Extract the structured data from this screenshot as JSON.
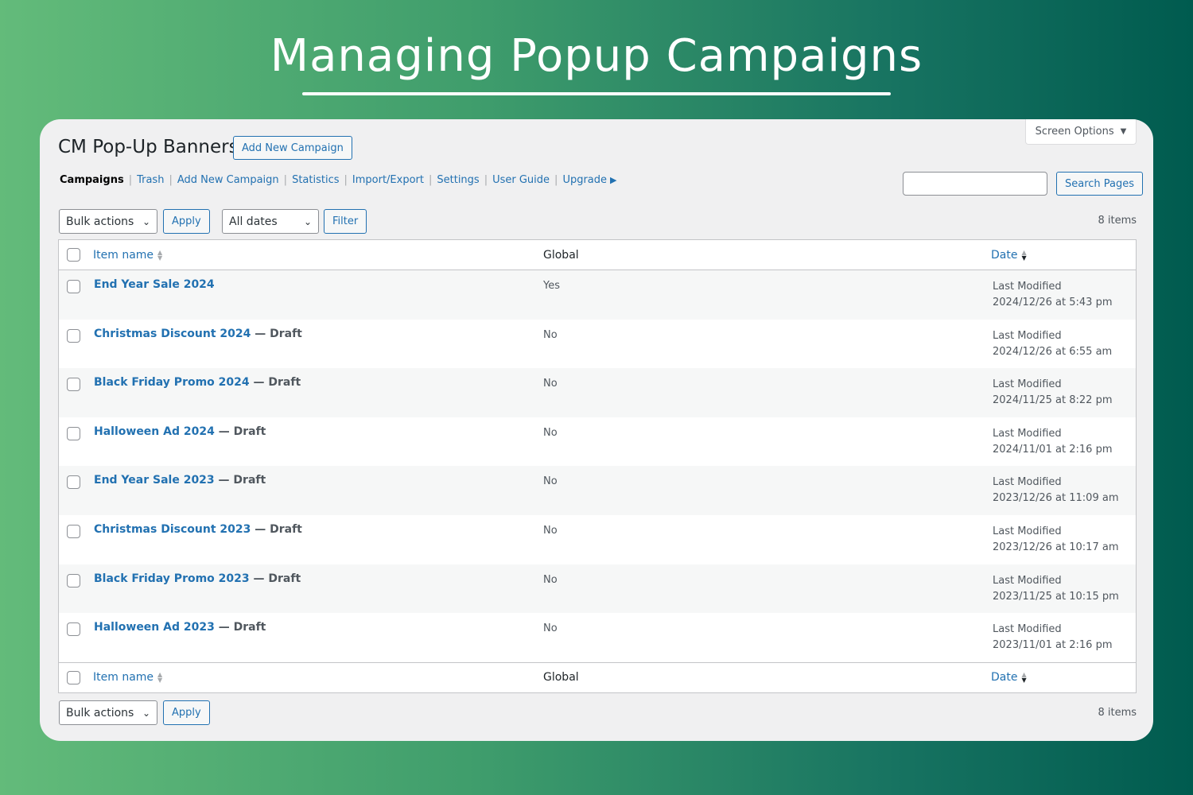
{
  "hero": {
    "title": "Managing Popup Campaigns"
  },
  "header": {
    "title": "CM Pop-Up Banners",
    "add_new_label": "Add New Campaign",
    "screen_options_label": "Screen Options",
    "screen_options_icon": "caret-down-icon"
  },
  "subnav": {
    "items": [
      {
        "label": "Campaigns",
        "current": true
      },
      {
        "label": "Trash"
      },
      {
        "label": "Add New Campaign"
      },
      {
        "label": "Statistics"
      },
      {
        "label": "Import/Export"
      },
      {
        "label": "Settings"
      },
      {
        "label": "User Guide"
      },
      {
        "label": "Upgrade"
      }
    ],
    "separator": "|",
    "upgrade_icon": "arrow-right-icon"
  },
  "search": {
    "value": "",
    "placeholder": "",
    "button_label": "Search Pages"
  },
  "toolbar_top": {
    "bulk_actions": "Bulk actions",
    "apply": "Apply",
    "dates": "All dates",
    "filter": "Filter",
    "count": "8 items"
  },
  "table": {
    "columns": {
      "name": "Item name",
      "global": "Global",
      "date": "Date"
    },
    "rows": [
      {
        "name": "End Year Sale 2024",
        "state": "",
        "global": "Yes",
        "date_label": "Last Modified",
        "date": "2024/12/26 at 5:43 pm"
      },
      {
        "name": "Christmas Discount 2024",
        "state": " — Draft",
        "global": "No",
        "date_label": "Last Modified",
        "date": "2024/12/26 at 6:55 am"
      },
      {
        "name": "Black Friday Promo 2024",
        "state": " — Draft",
        "global": "No",
        "date_label": "Last Modified",
        "date": "2024/11/25 at 8:22 pm"
      },
      {
        "name": "Halloween Ad 2024",
        "state": " — Draft",
        "global": "No",
        "date_label": "Last Modified",
        "date": "2024/11/01 at 2:16 pm"
      },
      {
        "name": "End Year Sale 2023",
        "state": " — Draft",
        "global": "No",
        "date_label": "Last Modified",
        "date": "2023/12/26 at 11:09 am"
      },
      {
        "name": "Christmas Discount 2023",
        "state": " — Draft",
        "global": "No",
        "date_label": "Last Modified",
        "date": "2023/12/26 at 10:17 am"
      },
      {
        "name": "Black Friday Promo 2023",
        "state": " — Draft",
        "global": "No",
        "date_label": "Last Modified",
        "date": "2023/11/25 at 10:15 pm"
      },
      {
        "name": "Halloween Ad 2023",
        "state": " — Draft",
        "global": "No",
        "date_label": "Last Modified",
        "date": "2023/11/01 at 2:16 pm"
      }
    ]
  },
  "toolbar_bottom": {
    "bulk_actions": "Bulk actions",
    "apply": "Apply",
    "count": "8 items"
  },
  "colors": {
    "accent": "#2271b1",
    "panel_bg": "#f0f0f1",
    "gradient_start": "#63bb7a",
    "gradient_end": "#005b4f"
  }
}
